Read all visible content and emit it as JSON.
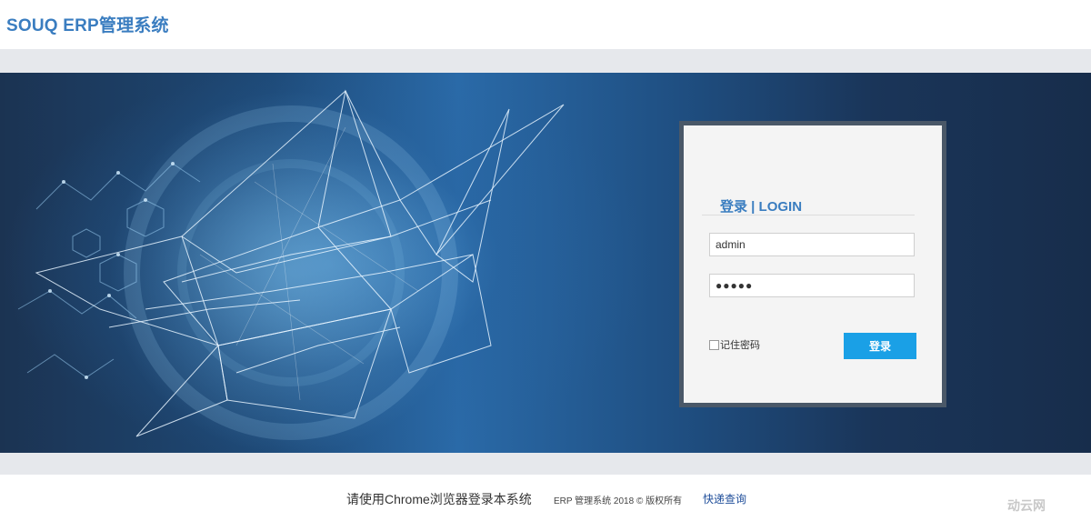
{
  "header": {
    "title": "SOUQ ERP管理系统"
  },
  "login": {
    "heading": "登录 | LOGIN",
    "username_value": "admin",
    "password_value": "●●●●●",
    "remember_label": "记住密码",
    "submit_label": "登录"
  },
  "footer": {
    "tip": "请使用Chrome浏览器登录本系统",
    "copyright": "ERP 管理系统 2018 © 版权所有",
    "link_label": "快递查询",
    "watermark": "动云网"
  },
  "colors": {
    "brand": "#3a7dc0",
    "button": "#1aa0e6",
    "hero_dark": "#1b3352",
    "hero_light": "#2a6aa8"
  }
}
